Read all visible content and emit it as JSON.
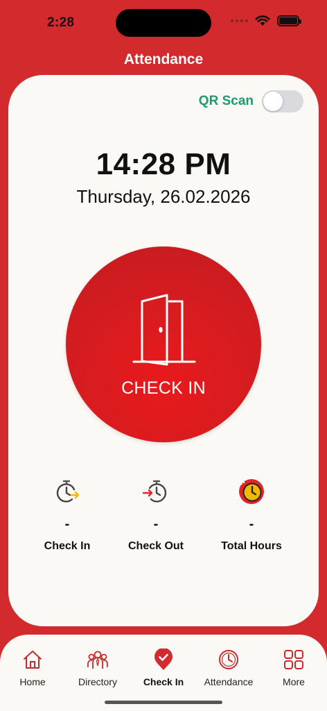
{
  "status_bar": {
    "time": "2:28"
  },
  "header": {
    "title": "Attendance"
  },
  "qr": {
    "label": "QR Scan",
    "enabled": false
  },
  "clock": {
    "time": "14:28 PM",
    "date": "Thursday, 26.02.2026"
  },
  "check_button": {
    "label": "CHECK IN",
    "icon": "door-icon"
  },
  "stats": [
    {
      "label": "Check In",
      "value": "-",
      "icon": "clock-check-in-icon"
    },
    {
      "label": "Check Out",
      "value": "-",
      "icon": "clock-check-out-icon"
    },
    {
      "label": "Total Hours",
      "value": "-",
      "icon": "total-hours-icon"
    }
  ],
  "tabs": [
    {
      "label": "Home",
      "icon": "home-icon",
      "active": false
    },
    {
      "label": "Directory",
      "icon": "people-icon",
      "active": false
    },
    {
      "label": "Check In",
      "icon": "location-check-icon",
      "active": true
    },
    {
      "label": "Attendance",
      "icon": "clock-icon",
      "active": false
    },
    {
      "label": "More",
      "icon": "grid-icon",
      "active": false
    }
  ],
  "colors": {
    "brand_red": "#d32a2e",
    "card_bg": "#fbf9f5",
    "qr_green": "#1f9a73",
    "accent_yellow": "#f5b800"
  }
}
